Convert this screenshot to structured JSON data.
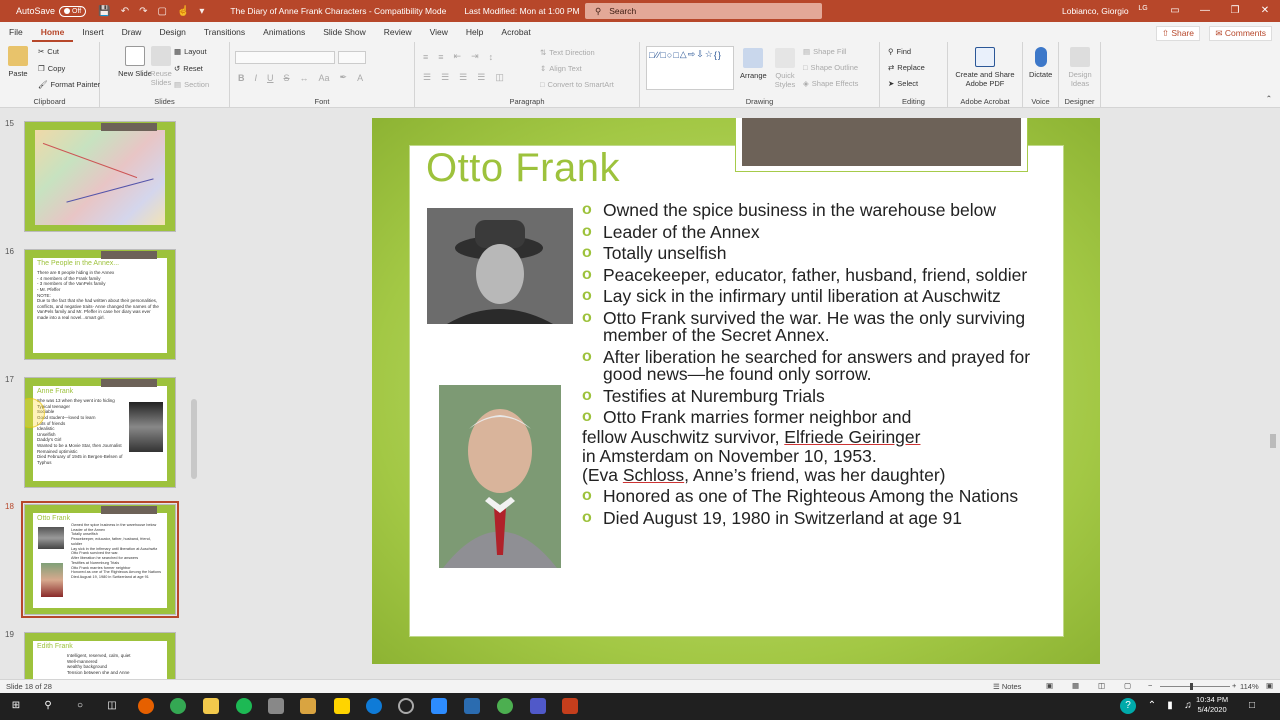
{
  "titlebar": {
    "autosave_label": "AutoSave",
    "autosave_state": "Off",
    "doc_title": "The Diary of Anne Frank Characters  -  Compatibility Mode",
    "last_modified": "Last Modified: Mon at 1:00 PM",
    "search_placeholder": "Search",
    "user": "Lobianco, Giorgio",
    "avatar": "LG"
  },
  "menu": {
    "tabs": [
      "File",
      "Home",
      "Insert",
      "Draw",
      "Design",
      "Transitions",
      "Animations",
      "Slide Show",
      "Review",
      "View",
      "Help",
      "Acrobat"
    ],
    "active": "Home",
    "share": "Share",
    "comments": "Comments"
  },
  "ribbon": {
    "clipboard": {
      "label": "Clipboard",
      "paste": "Paste",
      "cut": "Cut",
      "copy": "Copy",
      "format_painter": "Format Painter"
    },
    "slides": {
      "label": "Slides",
      "new_slide": "New Slide",
      "reuse_slides": "Reuse Slides",
      "layout": "Layout",
      "reset": "Reset",
      "section": "Section"
    },
    "font": {
      "label": "Font"
    },
    "paragraph": {
      "label": "Paragraph",
      "text_direction": "Text Direction",
      "align_text": "Align Text",
      "convert_smartart": "Convert to SmartArt"
    },
    "drawing": {
      "label": "Drawing",
      "arrange": "Arrange",
      "quick_styles": "Quick Styles",
      "shape_fill": "Shape Fill",
      "shape_outline": "Shape Outline",
      "shape_effects": "Shape Effects"
    },
    "editing": {
      "label": "Editing",
      "find": "Find",
      "replace": "Replace",
      "select": "Select"
    },
    "adobe": {
      "label": "Adobe Acrobat",
      "create_share": "Create and Share Adobe PDF"
    },
    "voice": {
      "label": "Voice",
      "dictate": "Dictate"
    },
    "designer": {
      "label": "Designer",
      "design_ideas": "Design Ideas"
    }
  },
  "thumbnails": [
    {
      "num": "15",
      "title": "",
      "text": ""
    },
    {
      "num": "16",
      "title": "The People in the Annex...",
      "text": "There are 8 people hiding in the Annex\n- 4 members of the Frank family\n- 3 members of the VanPels family\n- Mr. Pfeffer\nNOTE:\nDue to the fact that she had written about their personalities, conflicts, and negative traits- Anne changed the names of the VanPels family and Mr. Pfeffer in case her diary was ever made into a real novel...smart girl."
    },
    {
      "num": "17",
      "title": "Anne Frank",
      "text": "She was 13 when they went into hiding\nTypical teenager\nSociable\nGood student—loved to learn\nLots of friends\nIdealistic\nUnselfish\nDaddy's Girl\nWanted to be a Movie Star, then Journalist\nRemained optimistic\nDied February of 1945 in Bergen-Belsen of Typhus"
    },
    {
      "num": "18",
      "title": "Otto Frank",
      "text": "Owned the spice business in the warehouse below\nLeader of the Annex\nTotally unselfish\nPeacekeeper, educator, father, husband, friend, soldier\nLay sick in the infirmary until liberation at Auschwitz\nOtto Frank survived the war.\nAfter liberation he searched for answers\nTestifies at Nuremburg Trials\nOtto Frank marries former neighbor\nHonored as one of The Righteous Among the Nations\nDied August 19, 1980 in Switzerland at age 91"
    },
    {
      "num": "19",
      "title": "Edith Frank",
      "text": "Intelligent, reserved, calm, quiet\nWell-mannered\nwealthy background\nTension between she and Anne"
    }
  ],
  "slide": {
    "title": "Otto Frank",
    "bullets": [
      "Owned the spice business in the warehouse below",
      "Leader of the Annex",
      "Totally unselfish",
      "Peacekeeper, educator, father, husband, friend, soldier",
      "Lay sick in the infirmary until liberation at Auschwitz",
      "Otto Frank survived the war.  He was the only surviving member of the Secret Annex.",
      "After liberation he searched for answers and prayed for good news—he found only sorrow.",
      "Testifies at Nuremburg Trials",
      "Otto Frank marries former neighbor and"
    ],
    "plain_line_1_pre": "fellow Auschwitz survivor, ",
    "plain_line_1_link": "Elfriede Geiringer",
    "plain_line_2": "in Amsterdam on November 10, 1953.",
    "plain_line_3_pre": "(Eva ",
    "plain_line_3_link": "Schloss",
    "plain_line_3_post": ", Anne’s friend, was her daughter)",
    "bullets_end": [
      "Honored as one of The Righteous Among the Nations",
      "Died August 19, 1980 in Switzerland at age 91"
    ]
  },
  "status": {
    "slide_count": "Slide 18 of 28",
    "notes": "Notes",
    "zoom": "114%"
  },
  "taskbar": {
    "time": "10:34 PM",
    "date": "5/4/2020"
  },
  "colors": {
    "accent": "#b7472a",
    "theme_green": "#9dc23c",
    "theme_bar": "#6d6258"
  }
}
